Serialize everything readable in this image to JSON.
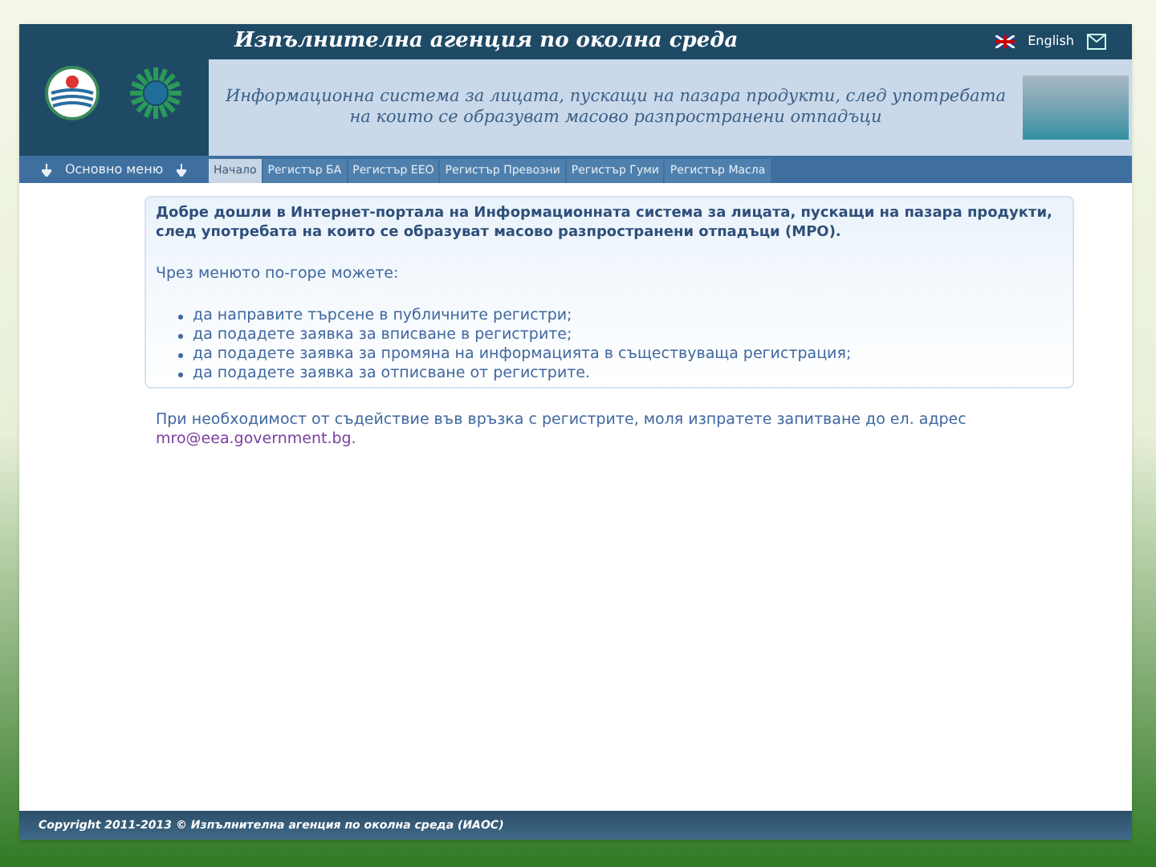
{
  "header": {
    "agency": "Изпълнителна агенция по околна среда",
    "language_link": "English",
    "subtitle_line_1": "Информационна система за лицата, пускащи на пазара продукти, след употребата",
    "subtitle_line_2": "на които се образуват масово разпространени отпадъци"
  },
  "side_menu": {
    "label": "Основно меню"
  },
  "tabs": [
    {
      "label": "Начало",
      "selected": true
    },
    {
      "label": "Регистър БА",
      "selected": false
    },
    {
      "label": "Регистър ЕЕО",
      "selected": false
    },
    {
      "label": "Регистър Превозни",
      "selected": false
    },
    {
      "label": "Регистър Гуми",
      "selected": false
    },
    {
      "label": "Регистър Масла",
      "selected": false
    }
  ],
  "welcome": "Добре дошли в Интернет-портала на Информационната система за лицата, пускащи на пазара продукти, след употребата на които се образуват масово разпространени отпадъци (МРО).",
  "intro": "Чрез менюто по-горе можете:",
  "options": [
    "да направите търсене в публичните регистри;",
    "да подадете заявка за вписване в регистрите;",
    "да подадете заявка за промяна на информацията в съществуваща регистрация;",
    "да подадете заявка за отписване от регистрите."
  ],
  "contact": "При необходимост от съдействие във връзка с регистрите, моля изпратете запитване до ел. адрес",
  "contact_email": "mro@eea.government.bg",
  "contact_end": ".",
  "footer": {
    "copyright": "Copyright 2011-2013 © Изпълнителна агенция по околна среда (ИАОС)"
  }
}
